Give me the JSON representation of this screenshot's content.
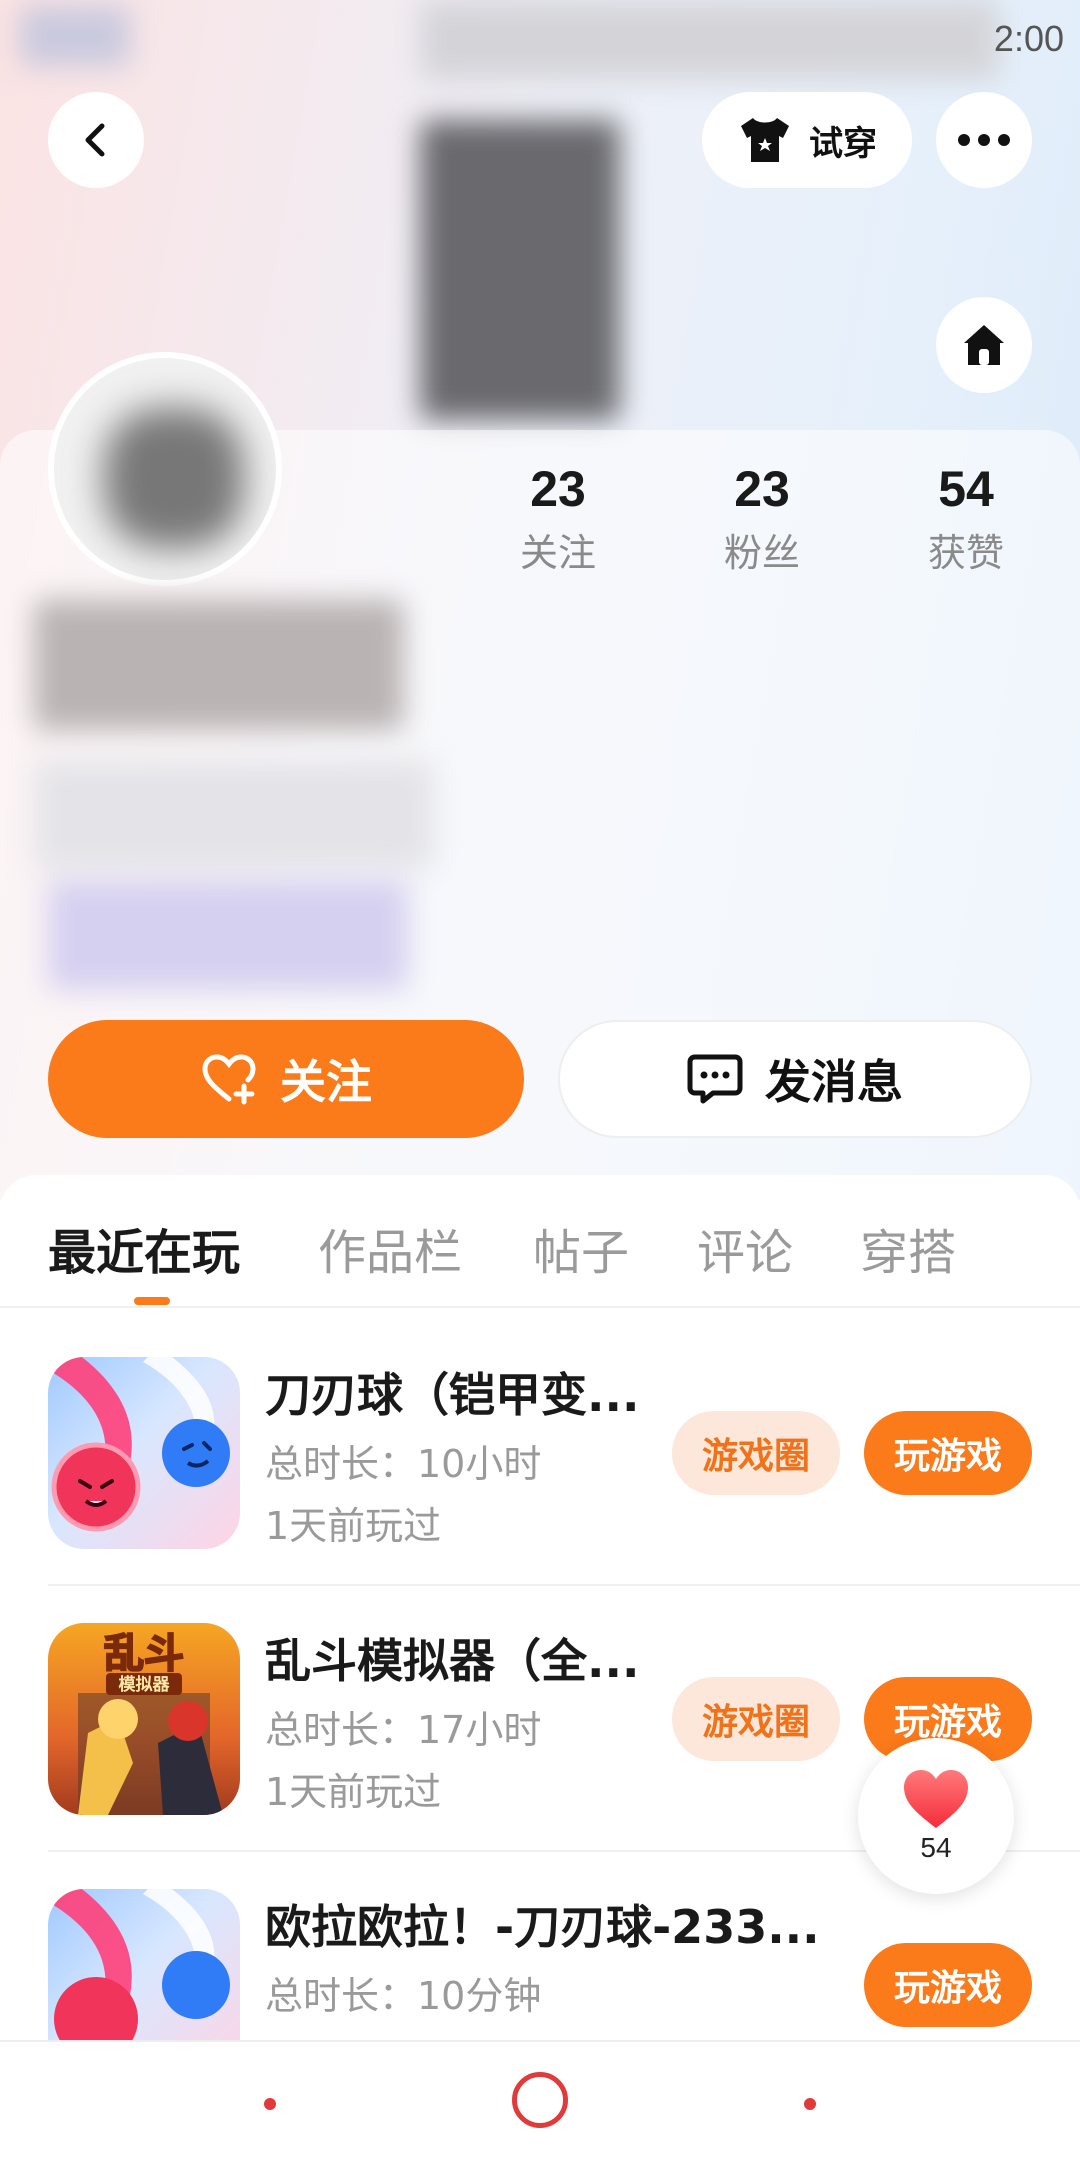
{
  "status_bar": {
    "time": "2:00"
  },
  "header": {
    "try_on_label": "试穿",
    "back_icon": "chevron-left-icon",
    "more_icon": "more-dots-icon",
    "home_icon": "home-icon",
    "try_on_icon": "tshirt-icon"
  },
  "stats": [
    {
      "value": "23",
      "label": "关注"
    },
    {
      "value": "23",
      "label": "粉丝"
    },
    {
      "value": "54",
      "label": "获赞"
    }
  ],
  "actions": {
    "follow_label": "关注",
    "message_label": "发消息"
  },
  "tabs": [
    "最近在玩",
    "作品栏",
    "帖子",
    "评论",
    "穿搭"
  ],
  "active_tab": 0,
  "games": [
    {
      "title": "刀刃球（铠甲变...",
      "duration": "总时长：10小时",
      "last_played": "1天前玩过",
      "circle_label": "游戏圈",
      "play_label": "玩游戏"
    },
    {
      "title": "乱斗模拟器（全...",
      "duration": "总时长：17小时",
      "last_played": "1天前玩过",
      "circle_label": "游戏圈",
      "play_label": "玩游戏",
      "icon_text": "乱斗",
      "icon_subtext": "模拟器"
    },
    {
      "title": "欧拉欧拉！-刀刃球-233...",
      "duration": "总时长：10分钟",
      "last_played": "",
      "play_label": "玩游戏"
    }
  ],
  "like_widget": {
    "count": "54"
  },
  "colors": {
    "accent": "#fb7a1a",
    "accent_light": "#fde7da",
    "nav_red": "#e03a3a"
  }
}
